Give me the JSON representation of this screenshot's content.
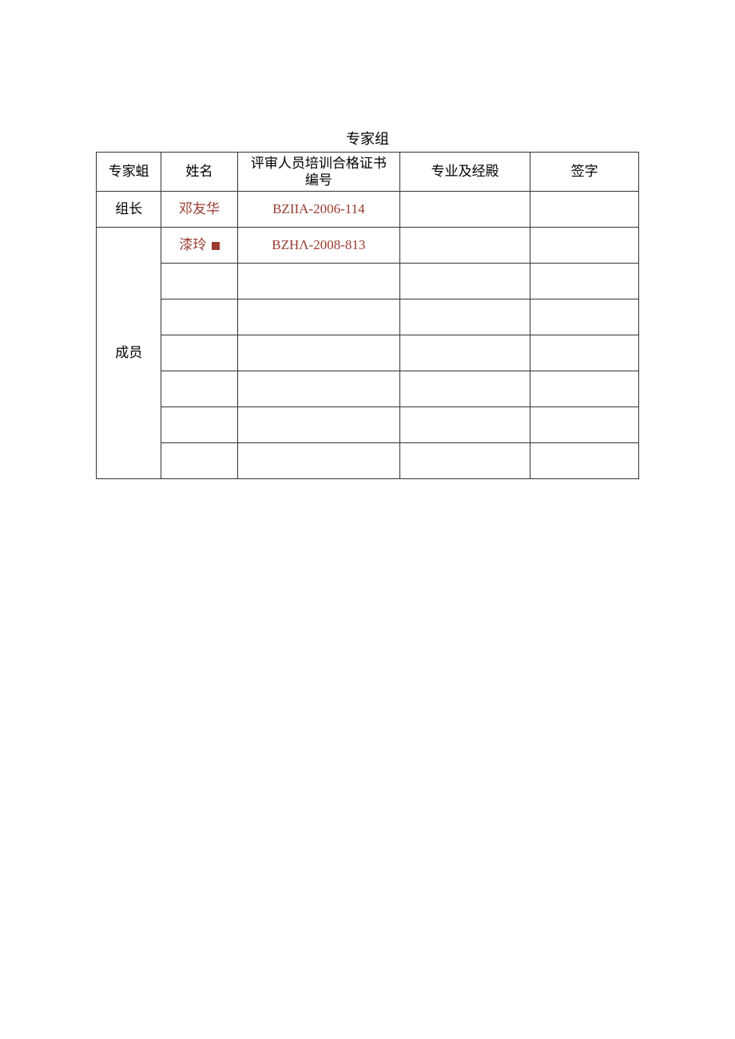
{
  "title": "专家组",
  "headers": {
    "role": "专家蛆",
    "name": "姓名",
    "cert": "评审人员培训合格证书\n编号",
    "domain": "专业及经殿",
    "sign": "签字"
  },
  "roles": {
    "leader": "组长",
    "member": "成员"
  },
  "rows": [
    {
      "name": "邓友华",
      "cert": "BZIIA-2006-114",
      "domain": "",
      "sign": ""
    },
    {
      "name": "漆玲",
      "cert": "BZHΛ-2008-813",
      "domain": "",
      "sign": "",
      "squareAfterName": true
    },
    {
      "name": "",
      "cert": "",
      "domain": "",
      "sign": ""
    },
    {
      "name": "",
      "cert": "",
      "domain": "",
      "sign": ""
    },
    {
      "name": "",
      "cert": "",
      "domain": "",
      "sign": ""
    },
    {
      "name": "",
      "cert": "",
      "domain": "",
      "sign": ""
    },
    {
      "name": "",
      "cert": "",
      "domain": "",
      "sign": ""
    },
    {
      "name": "",
      "cert": "",
      "domain": "",
      "sign": ""
    }
  ]
}
